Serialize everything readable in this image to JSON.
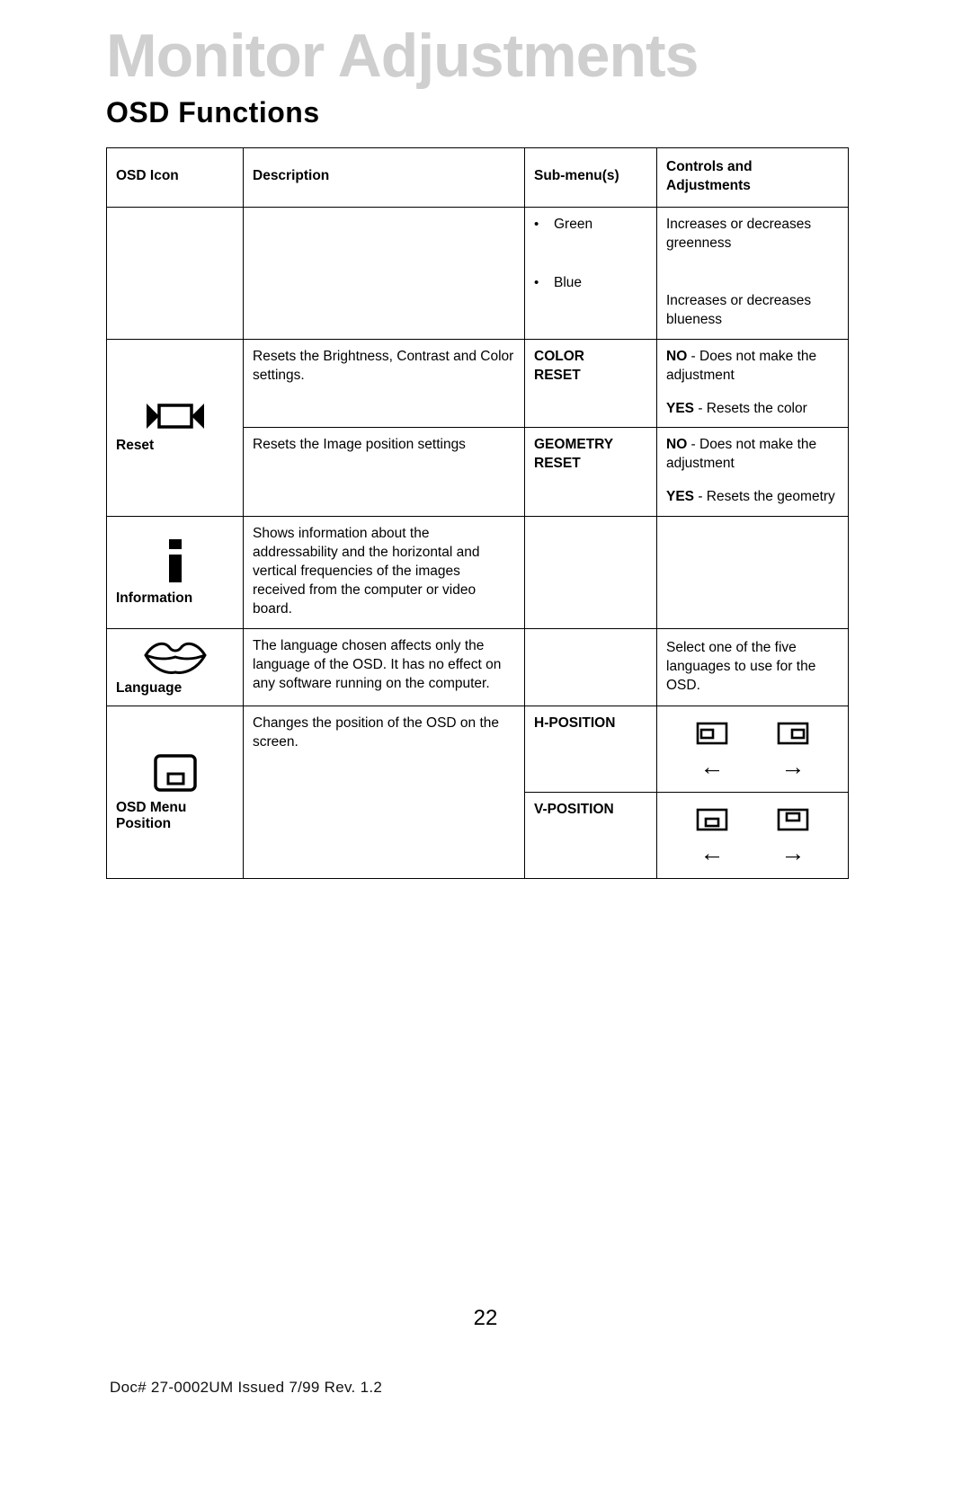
{
  "header": {
    "banner_title": "Monitor Adjustments",
    "section_title": "OSD Functions"
  },
  "table": {
    "columns": {
      "icon": "OSD Icon",
      "description": "Description",
      "submenu": "Sub-menu(s)",
      "controls": "Controls and Adjustments"
    },
    "rows": [
      {
        "icon_name": "",
        "icon_label": "",
        "description": "",
        "submenus": [
          {
            "label": "Green",
            "control": "Increases or decreases greenness"
          },
          {
            "label": "Blue",
            "control": "Increases or decreases blueness"
          }
        ]
      },
      {
        "icon_name": "reset-icon",
        "icon_label": "Reset",
        "sub_rows": [
          {
            "description": "Resets the Brightness, Contrast and Color settings.",
            "submenu_line1": "COLOR",
            "submenu_line2": "RESET",
            "control_no_bold": "NO",
            "control_no_text": " - Does not make the adjustment",
            "control_yes_bold": "YES",
            "control_yes_text": " - Resets the color"
          },
          {
            "description": "Resets the Image position settings",
            "submenu_line1": "GEOMETRY",
            "submenu_line2": "RESET",
            "control_no_bold": "NO",
            "control_no_text": " - Does not make the adjustment",
            "control_yes_bold": "YES",
            "control_yes_text": " - Resets the geometry"
          }
        ]
      },
      {
        "icon_name": "information-icon",
        "icon_label": "Information",
        "description": "Shows information about the addressability and the horizontal and vertical frequencies of the images received from the computer or video board.",
        "submenu": "",
        "control": ""
      },
      {
        "icon_name": "language-lips-icon",
        "icon_label": "Language",
        "description": "The language chosen affects only the language of the OSD. It has no effect on any software running on the computer.",
        "submenu": "",
        "control": "Select one of the five languages to use for the OSD."
      },
      {
        "icon_name": "osd-menu-position-icon",
        "icon_label_line1": "OSD Menu",
        "icon_label_line2": "Position",
        "description": "Changes the position of the OSD on the screen.",
        "sub_rows": [
          {
            "submenu": "H-POSITION",
            "left_icon_name": "osd-left-position-icon",
            "left_arrow": "←",
            "right_icon_name": "osd-right-position-icon",
            "right_arrow": "→"
          },
          {
            "submenu": "V-POSITION",
            "left_icon_name": "osd-bottom-position-icon",
            "left_arrow": "←",
            "right_icon_name": "osd-top-position-icon",
            "right_arrow": "→"
          }
        ]
      }
    ]
  },
  "footer": {
    "page_number": "22",
    "doc_line": "Doc# 27-0002UM  Issued 7/99  Rev. 1.2"
  },
  "colors": {
    "banner_gray": "#cfcfcf",
    "text_black": "#000000",
    "page_white": "#ffffff"
  }
}
